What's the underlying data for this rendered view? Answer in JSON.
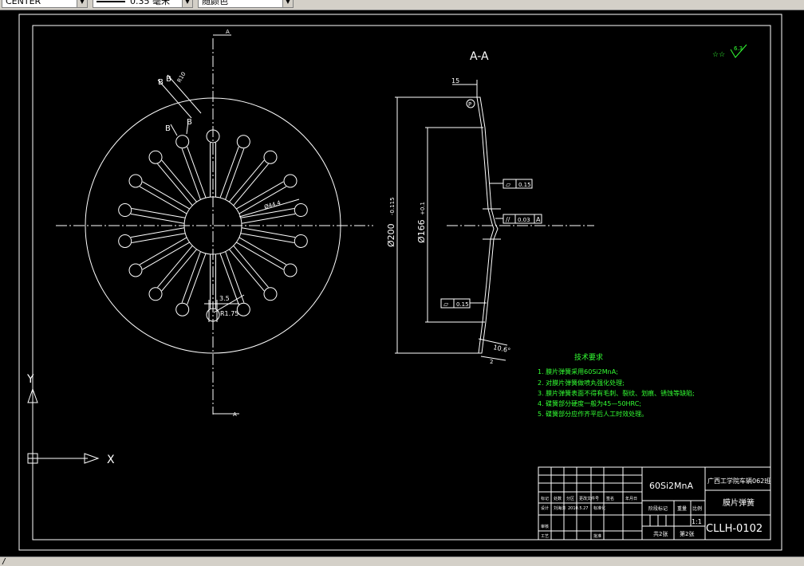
{
  "toolbar": {
    "layer_value": "CENTER",
    "lineweight_value": "0.35 毫米",
    "color_value": "随颜色"
  },
  "status": {
    "command_prompt": "/"
  },
  "drawing": {
    "section_label": "A-A",
    "surface_finish_sym": "☆☆",
    "surface_finish_val": "6.3",
    "axis_x_label": "X",
    "axis_y_label": "Y",
    "front_view": {
      "section_B1": "B",
      "section_B2": "B",
      "dim_r10": "R10",
      "dim_hole": "Ø44.4",
      "dim_slot": "3.5",
      "dim_r175": "R1.75",
      "arrow_a_top": "A",
      "arrow_a_bottom": "A"
    },
    "side_view": {
      "dim_15": "15",
      "dim_d200": "Ø200",
      "dim_d200_tol": "-0.115",
      "dim_d166": "Ø166",
      "dim_d166_tol": "+0.1",
      "tol_flat_top": "0.15",
      "tol_parallel": "0.03",
      "tol_parallel_datum": "A",
      "tol_flat_bottom": "0.15",
      "dim_angle": "10.6°",
      "dim_thk": "2"
    },
    "tech_req": {
      "title": "技术要求",
      "items": [
        "1. 膜片弹簧采用60Si2MnA;",
        "2. 对膜片弹簧做喷丸强化处理;",
        "3. 膜片弹簧表面不得有毛刺、裂纹、划痕、锈蚀等缺陷;",
        "4. 碟簧部分硬度一般为45—50HRC;",
        "5. 碟簧部分应作齐平后人工时效处理。"
      ]
    },
    "title_block": {
      "material": "60Si2MnA",
      "school": "广西工学院车辆062班",
      "part_name": "膜片弹簧",
      "drawing_no": "CLLH-0102",
      "scale": "1:1",
      "sheets_total": "共2张",
      "sheet_no": "第2张",
      "row_labels": [
        "标记",
        "处数",
        "分区",
        "更改文件号",
        "签名",
        "年月日"
      ],
      "designer_label": "设计",
      "designer_name": "刘海涛",
      "date": "2010.5.27",
      "std_label": "标准化",
      "check_label": "审核",
      "process_label": "工艺",
      "approve_label": "批准",
      "stage_label": "阶段标记",
      "weight_label": "重量",
      "scale_label": "比例"
    }
  }
}
